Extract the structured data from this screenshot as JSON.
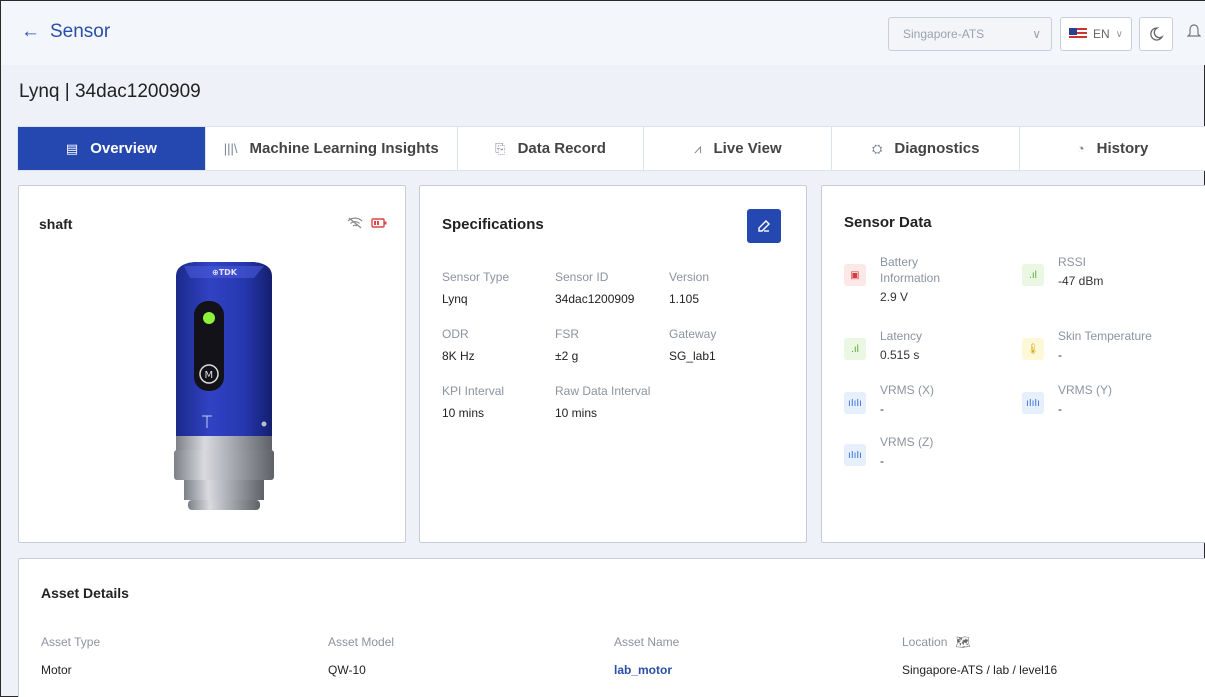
{
  "header": {
    "back_label": "Sensor",
    "region": "Singapore-ATS",
    "language": "EN"
  },
  "page": {
    "title": "Lynq | 34dac1200909"
  },
  "tabs": [
    {
      "label": "Overview",
      "icon": "document-icon",
      "active": true
    },
    {
      "label": "Machine Learning Insights",
      "icon": "books-icon",
      "active": false
    },
    {
      "label": "Data Record",
      "icon": "file-icon",
      "active": false
    },
    {
      "label": "Live View",
      "icon": "chart-icon",
      "active": false
    },
    {
      "label": "Diagnostics",
      "icon": "diagnostics-icon",
      "active": false
    },
    {
      "label": "History",
      "icon": "history-icon",
      "active": false
    }
  ],
  "shaft": {
    "title": "shaft",
    "status_icons": [
      "wifi-off-icon",
      "battery-icon"
    ]
  },
  "specs": {
    "title": "Specifications",
    "items": [
      {
        "label": "Sensor Type",
        "value": "Lynq"
      },
      {
        "label": "Sensor ID",
        "value": "34dac1200909"
      },
      {
        "label": "Version",
        "value": "1.105"
      },
      {
        "label": "ODR",
        "value": "8K Hz"
      },
      {
        "label": "FSR",
        "value": "±2 g"
      },
      {
        "label": "Gateway",
        "value": "SG_lab1"
      },
      {
        "label": "KPI Interval",
        "value": "10 mins"
      },
      {
        "label": "Raw Data Interval",
        "value": "10 mins"
      }
    ]
  },
  "sensor_data": {
    "title": "Sensor Data",
    "items": [
      {
        "label": "Battery Information",
        "value": "2.9 V",
        "icon": "battery-icon"
      },
      {
        "label": "RSSI",
        "value": "-47 dBm",
        "icon": "signal-icon"
      },
      {
        "label": "Latency",
        "value": "0.515 s",
        "icon": "signal-icon"
      },
      {
        "label": "Skin Temperature",
        "value": "-",
        "icon": "thermometer-icon"
      },
      {
        "label": "VRMS (X)",
        "value": "-",
        "icon": "waveform-icon"
      },
      {
        "label": "VRMS (Y)",
        "value": "-",
        "icon": "waveform-icon"
      },
      {
        "label": "VRMS (Z)",
        "value": "-",
        "icon": "waveform-icon"
      }
    ]
  },
  "asset": {
    "title": "Asset Details",
    "columns": [
      {
        "label": "Asset Type",
        "value": "Motor"
      },
      {
        "label": "Asset Model",
        "value": "QW-10"
      },
      {
        "label": "Asset Name",
        "value": "lab_motor"
      },
      {
        "label": "Location",
        "value": "Singapore-ATS / lab / level16"
      }
    ]
  },
  "colors": {
    "accent": "#2547b0",
    "link": "#2a4fa8",
    "battery": "#d83b3b",
    "signal": "#5aa43a",
    "temperature": "#d7a80c",
    "waveform": "#3a6fd6"
  }
}
